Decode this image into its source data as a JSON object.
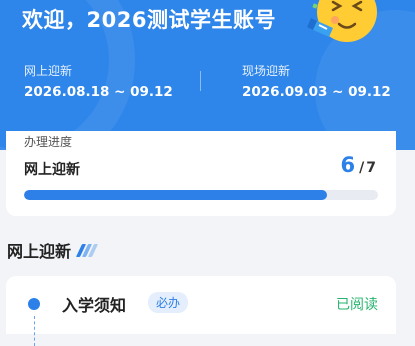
{
  "header": {
    "welcome": "欢迎，2026测试学生账号",
    "online": {
      "label": "网上迎新",
      "range": "2026.08.18 ~ 09.12"
    },
    "onsite": {
      "label": "现场迎新",
      "range": "2026.09.03 ~ 09.12"
    },
    "emoji_icon": "party-face-icon"
  },
  "progress": {
    "title": "办理进度",
    "stage": "网上迎新",
    "current": "6",
    "total": "7",
    "sep": "/",
    "fraction": 0.857,
    "bar_color": "#2c80e8"
  },
  "section": {
    "title": "网上迎新"
  },
  "tasks": [
    {
      "title": "入学须知",
      "badge": "必办",
      "status": "已阅读"
    }
  ],
  "colors": {
    "hero": "#2f86ea",
    "accent": "#2c80e8",
    "done": "#25b36d"
  }
}
